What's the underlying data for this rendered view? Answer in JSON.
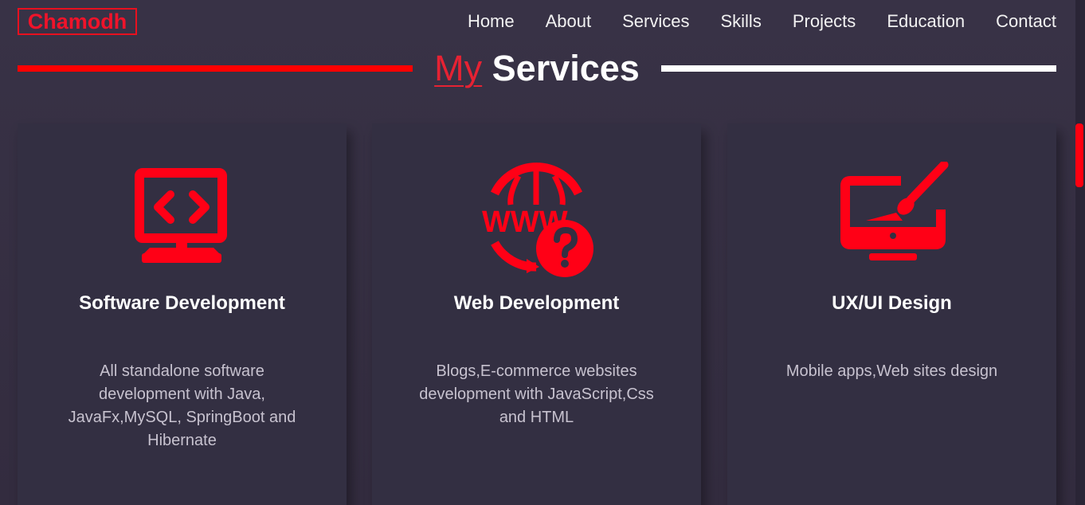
{
  "header": {
    "logo": "Chamodh",
    "nav": [
      "Home",
      "About",
      "Services",
      "Skills",
      "Projects",
      "Education",
      "Contact"
    ]
  },
  "section": {
    "title_prefix": "My",
    "title_main": "Services"
  },
  "services": [
    {
      "icon": "monitor-code-icon",
      "title": "Software Development",
      "description": "All standalone software development with Java, JavaFx,MySQL, SpringBoot and Hibernate"
    },
    {
      "icon": "www-question-globe-icon",
      "title": "Web Development",
      "description": "Blogs,E-commerce websites development with JavaScript,Css and HTML"
    },
    {
      "icon": "monitor-brush-icon",
      "title": "UX/UI Design",
      "description": "Mobile apps,Web sites design"
    }
  ],
  "colors": {
    "accent": "#ff0016",
    "background": "#363044",
    "card": "#332f42",
    "text_muted": "#c7c2cf"
  }
}
